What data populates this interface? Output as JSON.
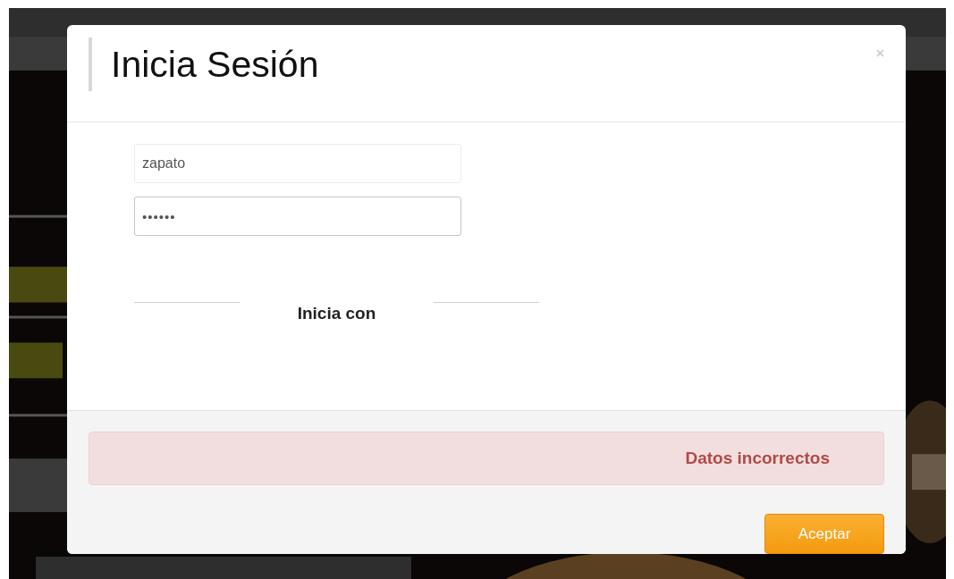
{
  "dialog": {
    "title": "Inicia Sesión",
    "fields": [
      {
        "kind": "text",
        "value": "zapato"
      },
      {
        "kind": "password",
        "value": "••••••"
      }
    ],
    "divider_label": "Inicia con",
    "alert": "Datos incorrectos",
    "buttons": [
      "Aceptar"
    ]
  }
}
